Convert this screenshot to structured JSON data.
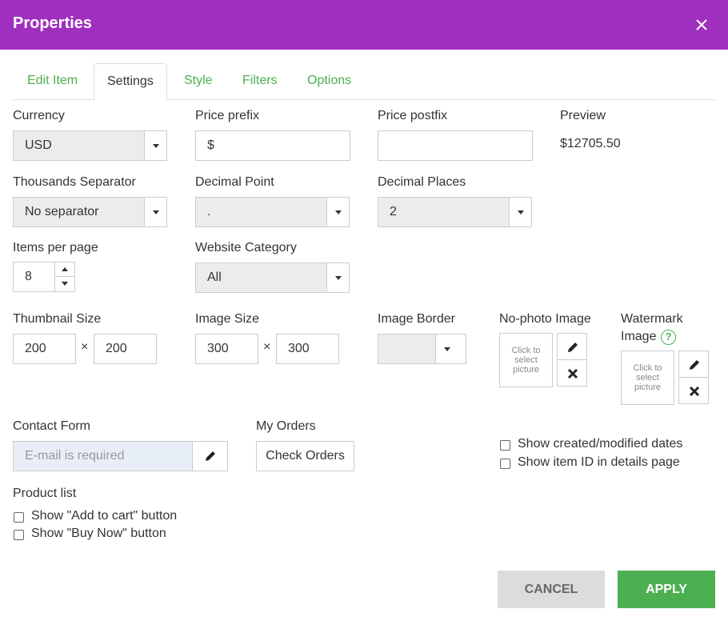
{
  "header": {
    "title": "Properties"
  },
  "tabs": [
    {
      "label": "Edit Item",
      "active": false
    },
    {
      "label": "Settings",
      "active": true
    },
    {
      "label": "Style",
      "active": false
    },
    {
      "label": "Filters",
      "active": false
    },
    {
      "label": "Options",
      "active": false
    }
  ],
  "settings": {
    "currency": {
      "label": "Currency",
      "value": "USD"
    },
    "price_prefix": {
      "label": "Price prefix",
      "value": "$"
    },
    "price_postfix": {
      "label": "Price postfix",
      "value": ""
    },
    "preview": {
      "label": "Preview",
      "value": "$12705.50"
    },
    "thousands_separator": {
      "label": "Thousands Separator",
      "value": "No separator"
    },
    "decimal_point": {
      "label": "Decimal Point",
      "value": "."
    },
    "decimal_places": {
      "label": "Decimal Places",
      "value": "2"
    },
    "items_per_page": {
      "label": "Items per page",
      "value": "8"
    },
    "website_category": {
      "label": "Website Category",
      "value": "All"
    },
    "thumbnail_size": {
      "label": "Thumbnail Size",
      "width": "200",
      "height": "200"
    },
    "image_size": {
      "label": "Image Size",
      "width": "300",
      "height": "300"
    },
    "times_symbol": "×",
    "image_border": {
      "label": "Image Border",
      "value": ""
    },
    "no_photo_image": {
      "label": "No-photo Image",
      "placeholder_lines": [
        "Click to",
        "select",
        "picture"
      ]
    },
    "watermark_image": {
      "label_line1": "Watermark",
      "label_line2": "Image",
      "help": "?",
      "placeholder_lines": [
        "Click to",
        "select",
        "picture"
      ]
    },
    "contact_form": {
      "label": "Contact Form",
      "placeholder": "E-mail is required"
    },
    "my_orders": {
      "label": "My Orders",
      "button": "Check Orders"
    },
    "show_dates": {
      "label": "Show created/modified dates",
      "checked": false
    },
    "show_item_id": {
      "label": "Show item ID in details page",
      "checked": false
    },
    "product_list": {
      "label": "Product list"
    },
    "show_add_to_cart": {
      "label": "Show \"Add to cart\" button",
      "checked": false
    },
    "show_buy_now": {
      "label": "Show \"Buy Now\" button",
      "checked": false
    }
  },
  "footer": {
    "cancel": "CANCEL",
    "apply": "APPLY"
  },
  "colors": {
    "header": "#9f2fbf",
    "accent": "#4caf50",
    "cancel_bg": "#dcdcdc"
  },
  "icons": {
    "close": "close-icon",
    "edit": "pencil-icon",
    "delete": "times-icon",
    "help": "help-icon"
  }
}
